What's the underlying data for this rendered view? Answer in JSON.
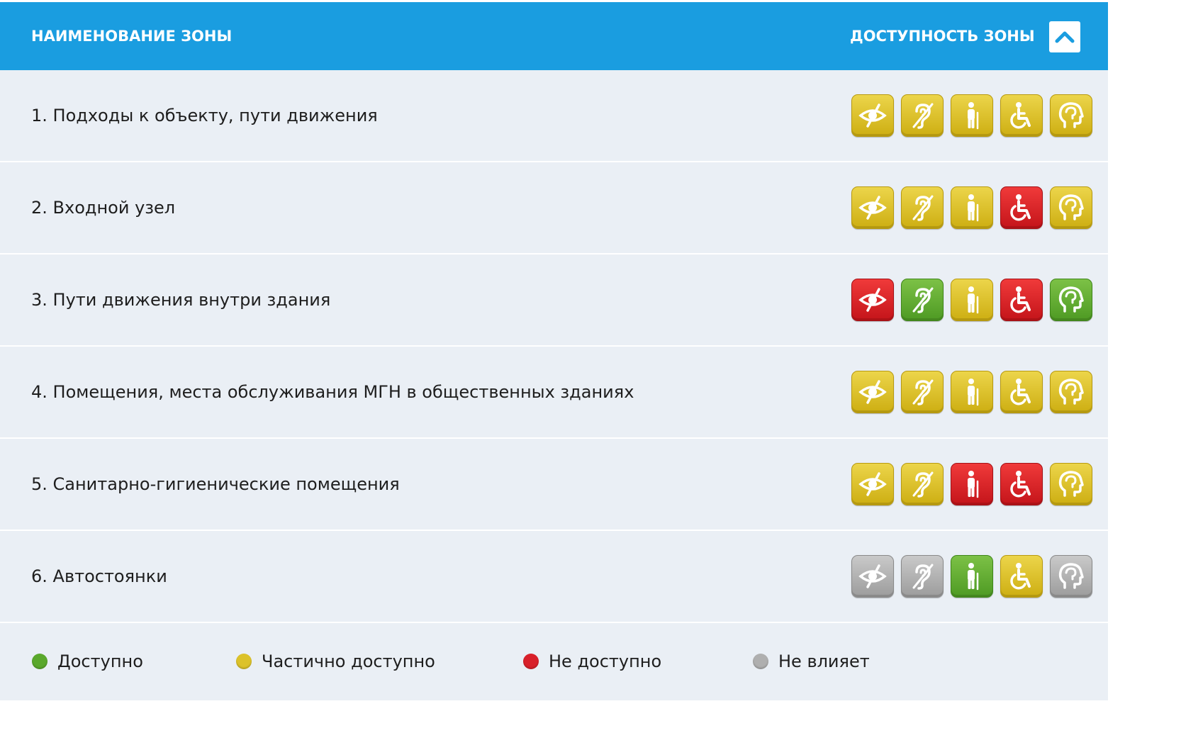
{
  "header": {
    "zone_name_title": "НАИМЕНОВАНИЕ ЗОНЫ",
    "accessibility_title": "ДОСТУПНОСТЬ ЗОНЫ",
    "collapse_icon": "chevron-up-icon"
  },
  "status_colors": {
    "green": "#5aa82c",
    "yellow": "#dcc22a",
    "red": "#d8202a",
    "gray": "#afafaf"
  },
  "icon_types": [
    "vision-impaired-icon",
    "hearing-impaired-icon",
    "mobility-impaired-icon",
    "wheelchair-icon",
    "mental-impaired-icon"
  ],
  "zones": [
    {
      "name": "1. Подходы к объекту, пути движения",
      "statuses": [
        "yellow",
        "yellow",
        "yellow",
        "yellow",
        "yellow"
      ]
    },
    {
      "name": "2. Входной узел",
      "statuses": [
        "yellow",
        "yellow",
        "yellow",
        "red",
        "yellow"
      ]
    },
    {
      "name": "3. Пути движения внутри здания",
      "statuses": [
        "red",
        "green",
        "yellow",
        "red",
        "green"
      ]
    },
    {
      "name": "4. Помещения, места обслуживания МГН в общественных зданиях",
      "statuses": [
        "yellow",
        "yellow",
        "yellow",
        "yellow",
        "yellow"
      ]
    },
    {
      "name": "5. Санитарно-гигиенические помещения",
      "statuses": [
        "yellow",
        "yellow",
        "red",
        "red",
        "yellow"
      ]
    },
    {
      "name": "6. Автостоянки",
      "statuses": [
        "gray",
        "gray",
        "green",
        "yellow",
        "gray"
      ]
    }
  ],
  "legend": [
    {
      "color": "green",
      "label": "Доступно"
    },
    {
      "color": "yellow",
      "label": "Частично доступно"
    },
    {
      "color": "red",
      "label": "Не доступно"
    },
    {
      "color": "gray",
      "label": "Не влияет"
    }
  ]
}
